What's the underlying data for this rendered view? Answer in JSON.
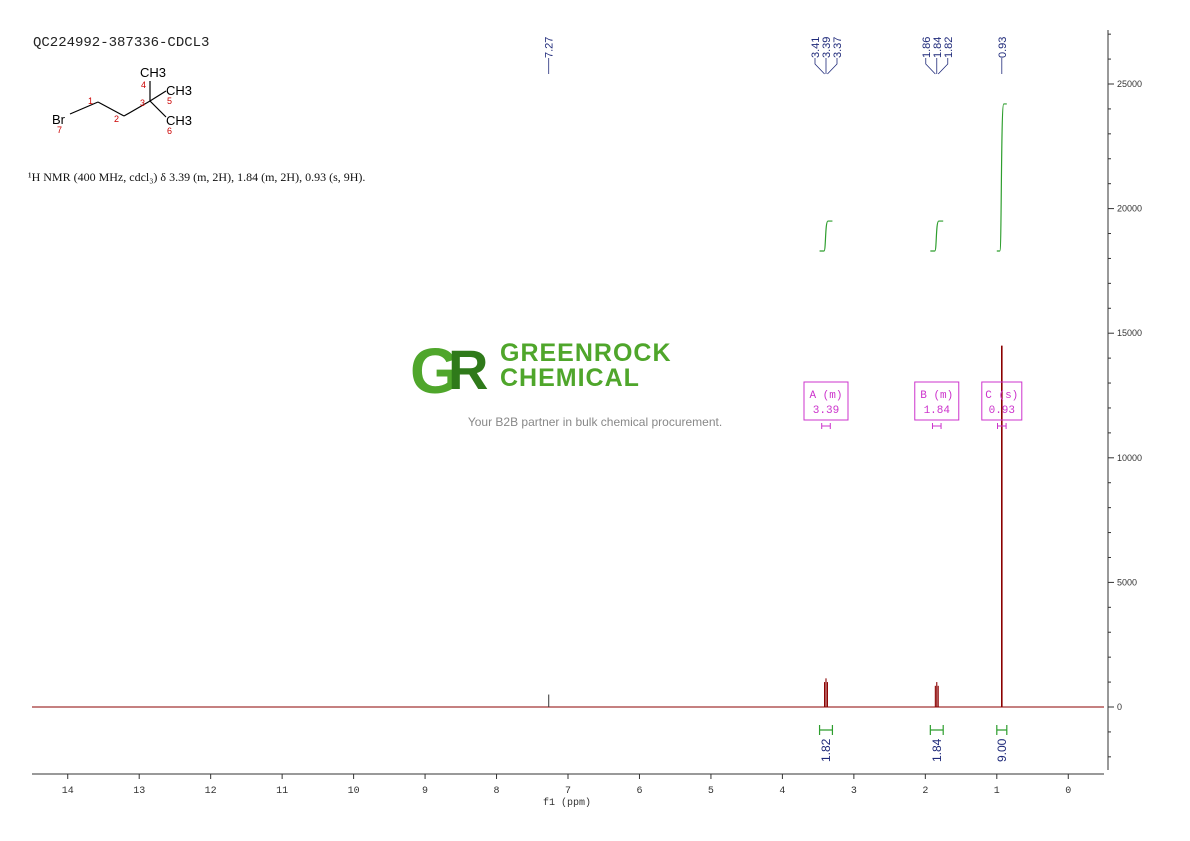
{
  "header": {
    "sample_id": "QC224992-387336-CDCL3",
    "nmr_description": "¹H NMR (400 MHz, cdcl₃) δ 3.39 (m, 2H), 1.84 (m, 2H), 0.93 (s, 9H)."
  },
  "structure": {
    "atoms": [
      {
        "label": "Br",
        "number": "7"
      },
      {
        "label": "CH3",
        "number": "4"
      },
      {
        "label": "CH3",
        "number": "5"
      },
      {
        "label": "CH3",
        "number": "6"
      }
    ],
    "carbon_numbers": [
      "1",
      "2",
      "3"
    ]
  },
  "watermark": {
    "brand_top": "GREENROCK",
    "brand_bottom": "CHEMICAL",
    "tagline": "Your B2B partner in bulk chemical procurement."
  },
  "colors": {
    "spectrum": "#8b0000",
    "integral": "#2e9e2e",
    "peak_label": "#1f2a7a",
    "multiplet_box": "#cc33cc",
    "brand_green": "#4fa62b",
    "axis": "#333333"
  },
  "chart_data": {
    "type": "line",
    "xlabel": "f1 (ppm)",
    "xlim": [
      14.5,
      -0.5
    ],
    "x_ticks": [
      14,
      13,
      12,
      11,
      10,
      9,
      8,
      7,
      6,
      5,
      4,
      3,
      2,
      1,
      0
    ],
    "ylim": [
      -2500,
      27000
    ],
    "y_ticks": [
      0,
      5000,
      10000,
      15000,
      20000,
      25000
    ],
    "y_tick_labels": [
      "0",
      "5000",
      "10000",
      "15000",
      "20000",
      "25000"
    ],
    "peaks": [
      {
        "ppm": 7.27,
        "intensity": 500
      },
      {
        "ppm": 3.41,
        "intensity": 1000
      },
      {
        "ppm": 3.39,
        "intensity": 1150
      },
      {
        "ppm": 3.37,
        "intensity": 1000
      },
      {
        "ppm": 1.86,
        "intensity": 850
      },
      {
        "ppm": 1.84,
        "intensity": 1000
      },
      {
        "ppm": 1.82,
        "intensity": 850
      },
      {
        "ppm": 0.93,
        "intensity": 14500
      }
    ],
    "peak_labels": [
      {
        "group": "solvent",
        "ppm_values": [
          7.27
        ],
        "labels": [
          "7.27"
        ]
      },
      {
        "group": "A",
        "ppm_values": [
          3.41,
          3.39,
          3.37
        ],
        "labels": [
          "3.41",
          "3.39",
          "3.37"
        ]
      },
      {
        "group": "B",
        "ppm_values": [
          1.86,
          1.84,
          1.82
        ],
        "labels": [
          "1.86",
          "1.84",
          "1.82"
        ]
      },
      {
        "group": "C",
        "ppm_values": [
          0.93
        ],
        "labels": [
          "0.93"
        ]
      }
    ],
    "multiplets": [
      {
        "letter": "A",
        "type": "(m)",
        "shift": "3.39",
        "range": [
          3.45,
          3.33
        ]
      },
      {
        "letter": "B",
        "type": "(m)",
        "shift": "1.84",
        "range": [
          1.9,
          1.78
        ]
      },
      {
        "letter": "C",
        "type": "(s)",
        "shift": "0.93",
        "range": [
          0.99,
          0.87
        ]
      }
    ],
    "integrals": [
      {
        "value": "1.82",
        "from": 3.48,
        "to": 3.3,
        "y_start": 18300,
        "y_end": 19500
      },
      {
        "value": "1.84",
        "from": 1.93,
        "to": 1.75,
        "y_start": 18300,
        "y_end": 19500
      },
      {
        "value": "9.00",
        "from": 1.0,
        "to": 0.86,
        "y_start": 18300,
        "y_end": 24200
      }
    ]
  }
}
